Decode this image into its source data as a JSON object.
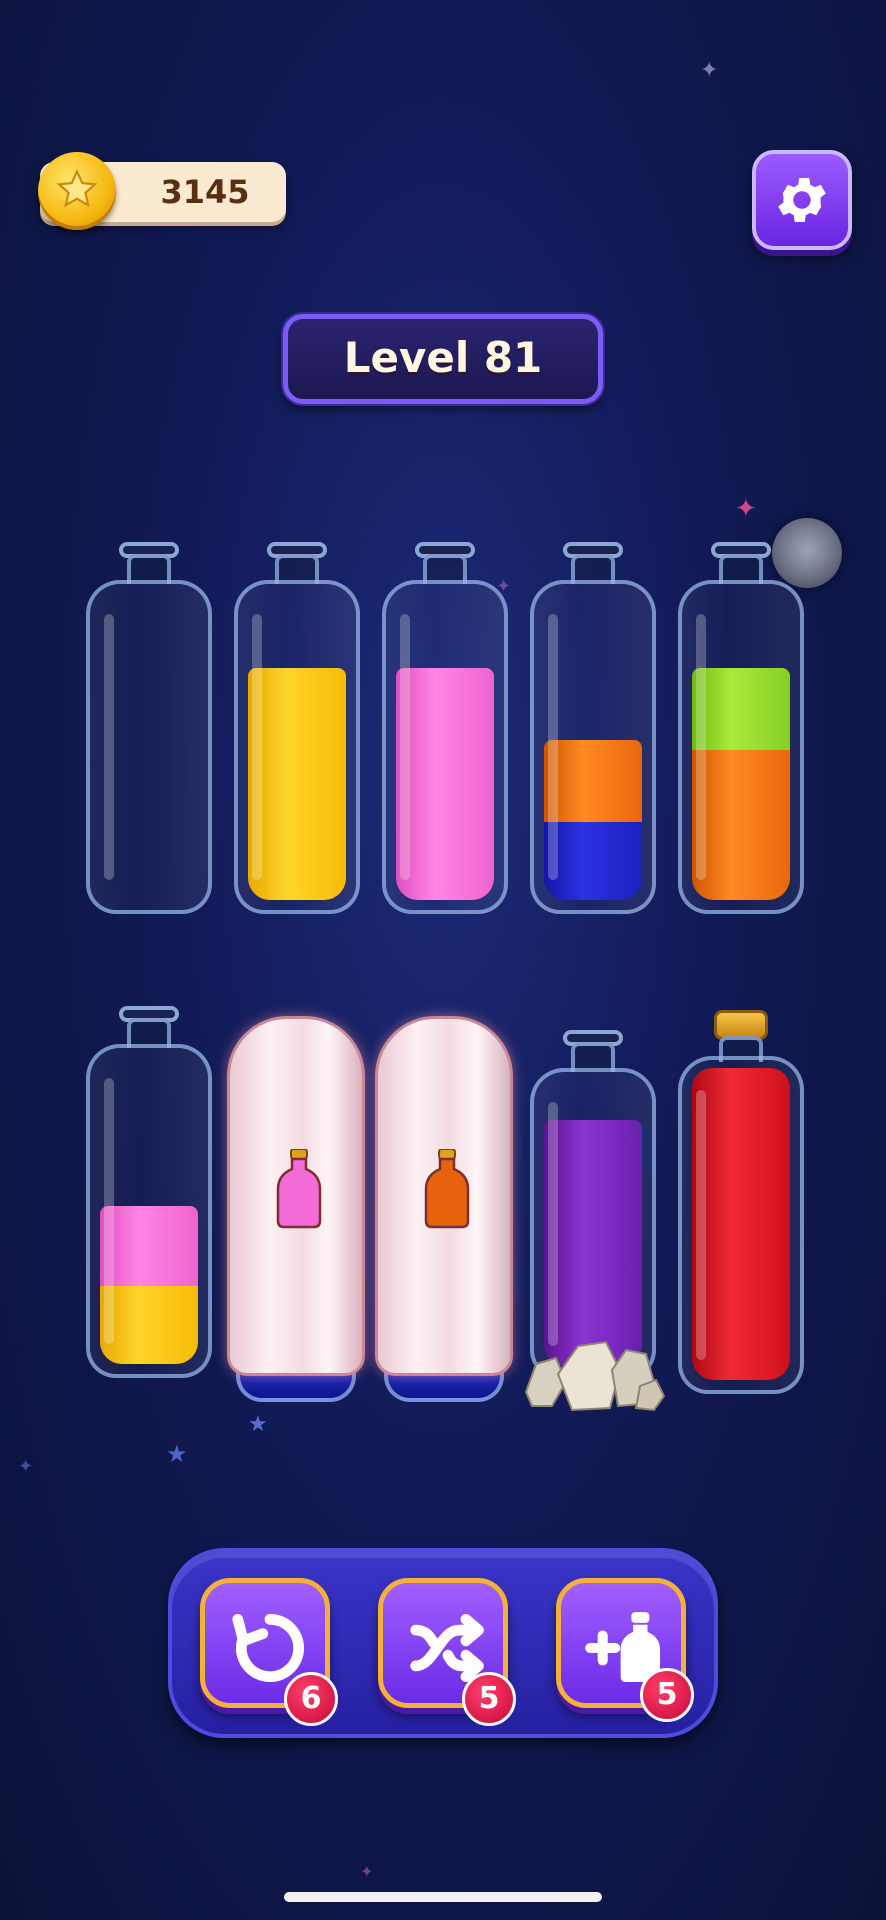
{
  "header": {
    "coins": "3145",
    "coin_icon": "gold-star-coin-icon",
    "settings_icon": "gear-icon"
  },
  "level": {
    "label": "Level 81"
  },
  "colors": {
    "yellow": "#f7c51a",
    "pink": "#f36bd6",
    "orange": "#e8640c",
    "blue": "#1f24c8",
    "green": "#8ed424",
    "purple": "#6d1fb0",
    "red": "#d7101d"
  },
  "bottles_row1": [
    {
      "id": 1,
      "state": "empty",
      "layers_bottom_to_top": []
    },
    {
      "id": 2,
      "state": "open",
      "layers_bottom_to_top": [
        "yellow"
      ],
      "fill_fraction": 0.75
    },
    {
      "id": 3,
      "state": "open",
      "layers_bottom_to_top": [
        "pink"
      ],
      "fill_fraction": 0.75
    },
    {
      "id": 4,
      "state": "open",
      "layers_bottom_to_top": [
        "blue",
        "orange"
      ],
      "fill_fraction": 0.5
    },
    {
      "id": 5,
      "state": "open",
      "layers_bottom_to_top": [
        "orange",
        "green"
      ],
      "fill_fraction": 0.75
    }
  ],
  "bottles_row2": [
    {
      "id": 6,
      "state": "open",
      "layers_bottom_to_top": [
        "yellow",
        "pink"
      ],
      "fill_fraction": 0.5
    },
    {
      "id": 7,
      "state": "covered",
      "hint_color": "pink"
    },
    {
      "id": 8,
      "state": "covered",
      "hint_color": "orange"
    },
    {
      "id": 9,
      "state": "rock-base",
      "layers_bottom_to_top": [
        "purple"
      ],
      "fill_fraction": 0.75
    },
    {
      "id": 10,
      "state": "corked-complete",
      "layers_bottom_to_top": [
        "red"
      ],
      "fill_fraction": 1.0
    }
  ],
  "toolbar": {
    "undo": {
      "icon": "undo-icon",
      "count": "6"
    },
    "shuffle": {
      "icon": "shuffle-icon",
      "count": "5"
    },
    "add_bottle": {
      "icon": "add-bottle-icon",
      "count": "5"
    }
  }
}
